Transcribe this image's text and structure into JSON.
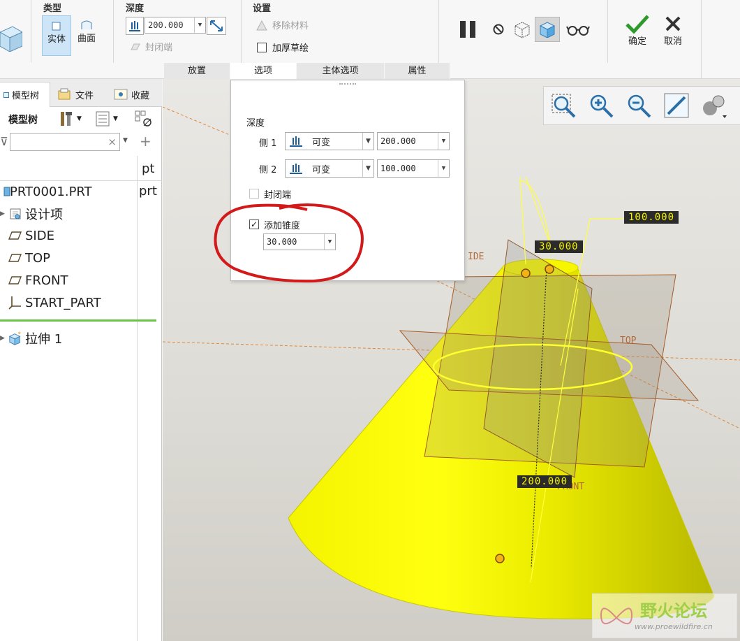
{
  "ribbon": {
    "type_group": {
      "title": "类型",
      "solid_label": "实体",
      "surface_label": "曲面"
    },
    "depth_group": {
      "title": "深度",
      "depth_value": "200.000",
      "closed_ends_label": "封闭端"
    },
    "settings_group": {
      "title": "设置",
      "remove_material_label": "移除材料",
      "thicken_sketch_label": "加厚草绘"
    },
    "ok_label": "确定",
    "cancel_label": "取消",
    "tabs": [
      {
        "label": "放置"
      },
      {
        "label": "选项"
      },
      {
        "label": "主体选项"
      },
      {
        "label": "属性"
      }
    ]
  },
  "left_panel": {
    "tabs": [
      {
        "label": "模型树"
      },
      {
        "label": "文件"
      },
      {
        "label": "收藏"
      }
    ],
    "toolbar_label": "模型树",
    "column_header": "pt",
    "tree": [
      {
        "label": "PRT0001.PRT",
        "col2": "prt",
        "icon": "part-icon"
      },
      {
        "label": "设计项",
        "icon": "design-items-icon"
      },
      {
        "label": "SIDE",
        "icon": "datum-plane-icon"
      },
      {
        "label": "TOP",
        "icon": "datum-plane-icon"
      },
      {
        "label": "FRONT",
        "icon": "datum-plane-icon"
      },
      {
        "label": "START_PART",
        "icon": "coordinate-system-icon"
      },
      {
        "label": "拉伸 1",
        "icon": "extrude-icon"
      }
    ]
  },
  "options_panel": {
    "depth_label": "深度",
    "side1_label": "侧 1",
    "side1_type": "可变",
    "side1_value": "200.000",
    "side2_label": "侧 2",
    "side2_type": "可变",
    "side2_value": "100.000",
    "closed_ends_label": "封闭端",
    "closed_ends_checked": false,
    "add_taper_label": "添加锥度",
    "add_taper_checked": true,
    "taper_value": "30.000"
  },
  "viewport": {
    "dim_taper": "30.000",
    "dim_side2": "100.000",
    "dim_side1": "200.000",
    "plane_labels": [
      "IDE",
      "TOP",
      "FRONT"
    ],
    "model_color": "#ffff00"
  },
  "watermark": {
    "title": "野火论坛",
    "url": "www.proewildfire.cn"
  },
  "colors": {
    "accent": "#cde5f7",
    "annotation_red": "#d21a1a",
    "confirm_green": "#2e9a2e"
  }
}
